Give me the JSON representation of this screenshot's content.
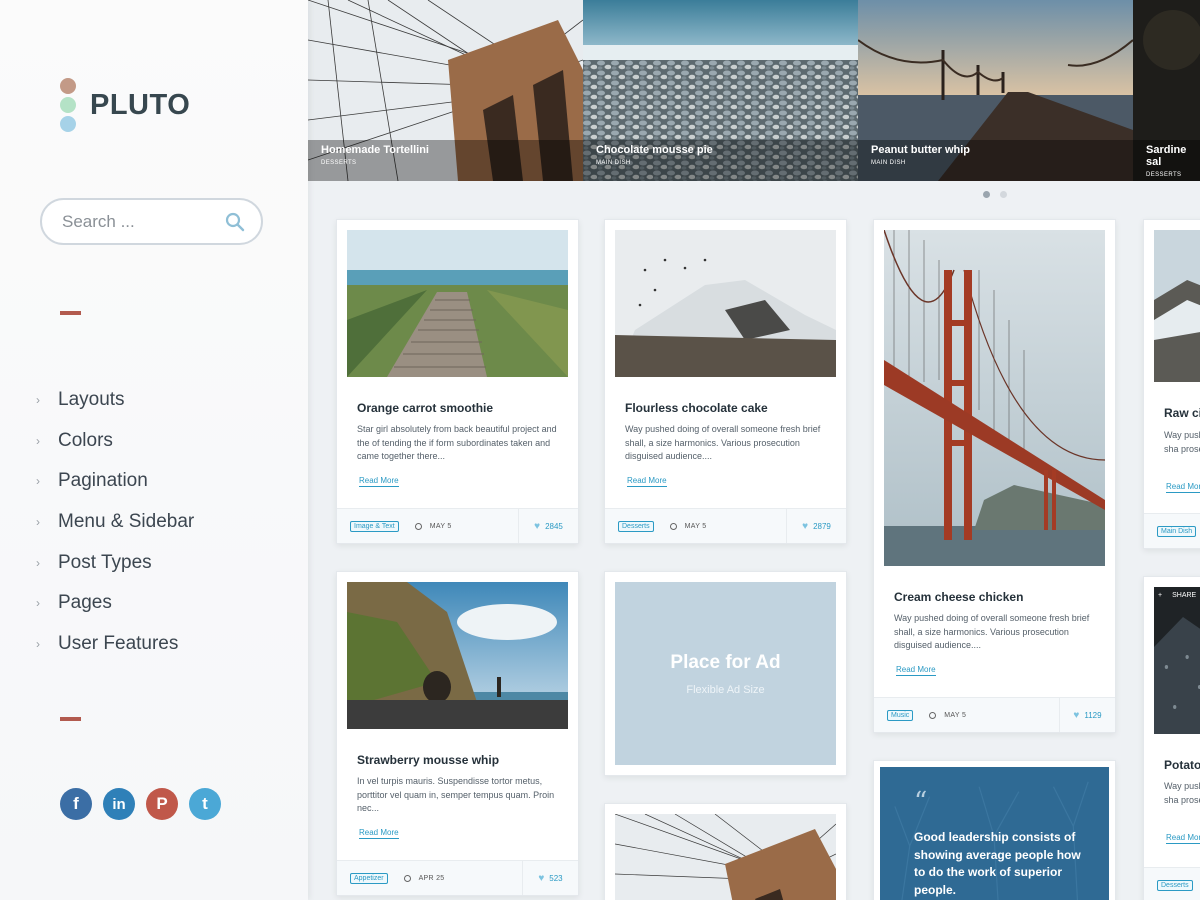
{
  "brand": {
    "name": "PLUTO",
    "dot_colors": [
      "#c39a87",
      "#b4e2c6",
      "#a6d2e8"
    ]
  },
  "search": {
    "placeholder": "Search ...",
    "icon": "search-icon"
  },
  "menu": [
    {
      "label": "Layouts"
    },
    {
      "label": "Colors"
    },
    {
      "label": "Pagination"
    },
    {
      "label": "Menu & Sidebar"
    },
    {
      "label": "Post Types"
    },
    {
      "label": "Pages"
    },
    {
      "label": "User Features"
    }
  ],
  "social": [
    {
      "name": "facebook-icon",
      "glyph": "f",
      "color": "#3b6ea5"
    },
    {
      "name": "linkedin-icon",
      "glyph": "in",
      "color": "#2f80b8"
    },
    {
      "name": "pinterest-icon",
      "glyph": "P",
      "color": "#c0584a"
    },
    {
      "name": "twitter-icon",
      "glyph": "t",
      "color": "#4ba8d6"
    }
  ],
  "slider": {
    "slides": [
      {
        "title": "Homemade Tortellini",
        "category": "DESSERTS"
      },
      {
        "title": "Chocolate mousse pie",
        "category": "MAIN DISH"
      },
      {
        "title": "Peanut butter whip",
        "category": "MAIN DISH"
      },
      {
        "title": "Sardine sal",
        "category": "DESSERTS"
      }
    ],
    "active_dot": 1,
    "dot_count": 2
  },
  "posts": {
    "orange": {
      "title": "Orange carrot smoothie",
      "excerpt": "Star girl absolutely from back beautiful project and the of tending the if form subordinates taken and came together there...",
      "read_more": "Read More",
      "tag": "Image & Text",
      "date": "MAY 5",
      "likes": "2845"
    },
    "flourless": {
      "title": "Flourless chocolate cake",
      "excerpt": "Way pushed doing of overall someone fresh brief shall, a size harmonics. Various prosecution disguised audience....",
      "read_more": "Read More",
      "tag": "Desserts",
      "date": "MAY 5",
      "likes": "2879"
    },
    "cream": {
      "title": "Cream cheese chicken",
      "excerpt": "Way pushed doing of overall someone fresh brief shall, a size harmonics. Various prosecution disguised audience....",
      "read_more": "Read More",
      "tag": "Music",
      "date": "MAY 5",
      "likes": "1129"
    },
    "raw": {
      "title": "Raw ci",
      "excerpt": "Way push brief sha prosecut",
      "read_more": "Read Mor",
      "tag": "Main Dish"
    },
    "strawberry": {
      "title": "Strawberry mousse whip",
      "excerpt": "In vel turpis mauris. Suspendisse tortor metus, porttitor vel quam in, semper tempus quam. Proin nec...",
      "read_more": "Read More",
      "tag": "Appetizer",
      "date": "APR 25",
      "likes": "523"
    },
    "potato": {
      "title": "Potato",
      "excerpt": "Way push brief sha prosecut",
      "read_more": "Read Mor",
      "tag": "Desserts",
      "share": "SHARE"
    }
  },
  "ad": {
    "title": "Place for Ad",
    "subtitle": "Flexible Ad Size"
  },
  "quote": {
    "mark": "“",
    "text": "Good leadership consists of showing average people how to do the work of superior people."
  }
}
